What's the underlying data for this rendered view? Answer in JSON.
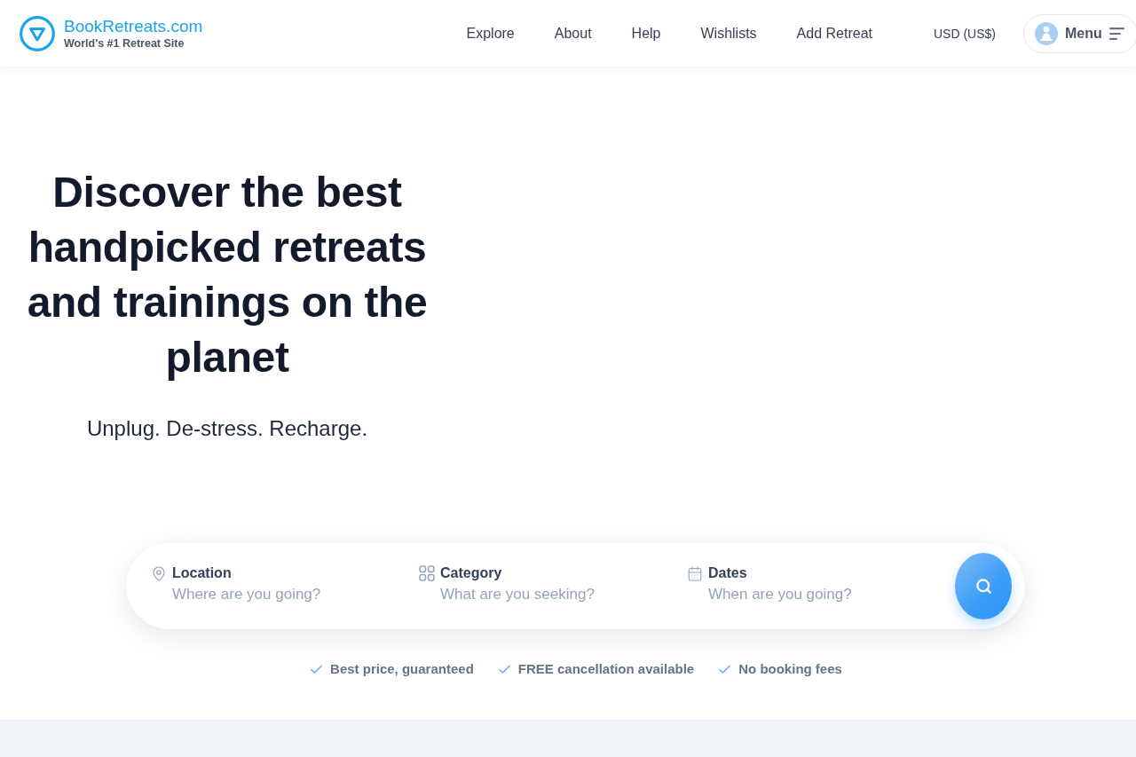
{
  "header": {
    "logo": {
      "name": "BookRetreats.com",
      "tagline": "World's #1 Retreat Site"
    },
    "nav": [
      "Explore",
      "About",
      "Help",
      "Wishlists",
      "Add Retreat"
    ],
    "currency": "USD (US$)",
    "menu": {
      "label": "Menu"
    }
  },
  "hero": {
    "title": "Discover the best handpicked retreats and trainings on the planet",
    "subtitle": "Unplug. De-stress. Recharge."
  },
  "search": {
    "fields": [
      {
        "label": "Location",
        "placeholder": "Where are you going?"
      },
      {
        "label": "Category",
        "placeholder": "What are you seeking?"
      },
      {
        "label": "Dates",
        "placeholder": "When are you going?"
      }
    ]
  },
  "benefits": [
    "Best price, guaranteed",
    "FREE cancellation available",
    "No booking fees"
  ]
}
